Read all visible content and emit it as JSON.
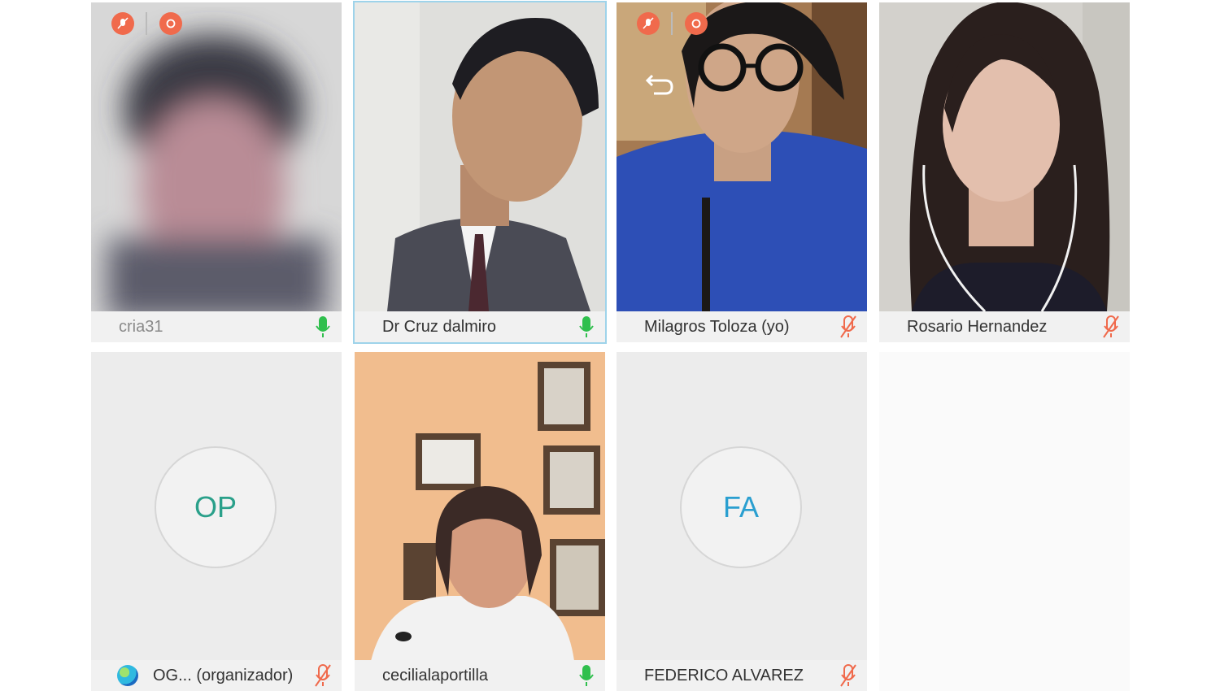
{
  "meeting": {
    "participants": [
      {
        "name": "cria31",
        "mic": "on"
      },
      {
        "name": "Dr Cruz dalmiro",
        "mic": "on"
      },
      {
        "name": "Milagros Toloza (yo)",
        "mic": "muted"
      },
      {
        "name": "Rosario Hernandez",
        "mic": "muted"
      },
      {
        "name": "OG... (organizador)",
        "initials": "OP",
        "mic": "muted"
      },
      {
        "name": "cecilialaportilla",
        "mic": "on"
      },
      {
        "name": "FEDERICO ALVAREZ",
        "initials": "FA",
        "mic": "muted"
      }
    ]
  },
  "colors": {
    "mic_on": "#2fbf4d",
    "mic_muted": "#f06a4c",
    "active_border": "#9ed3ea",
    "initials_op": "#2aa08a",
    "initials_fa": "#2a9fd0"
  }
}
